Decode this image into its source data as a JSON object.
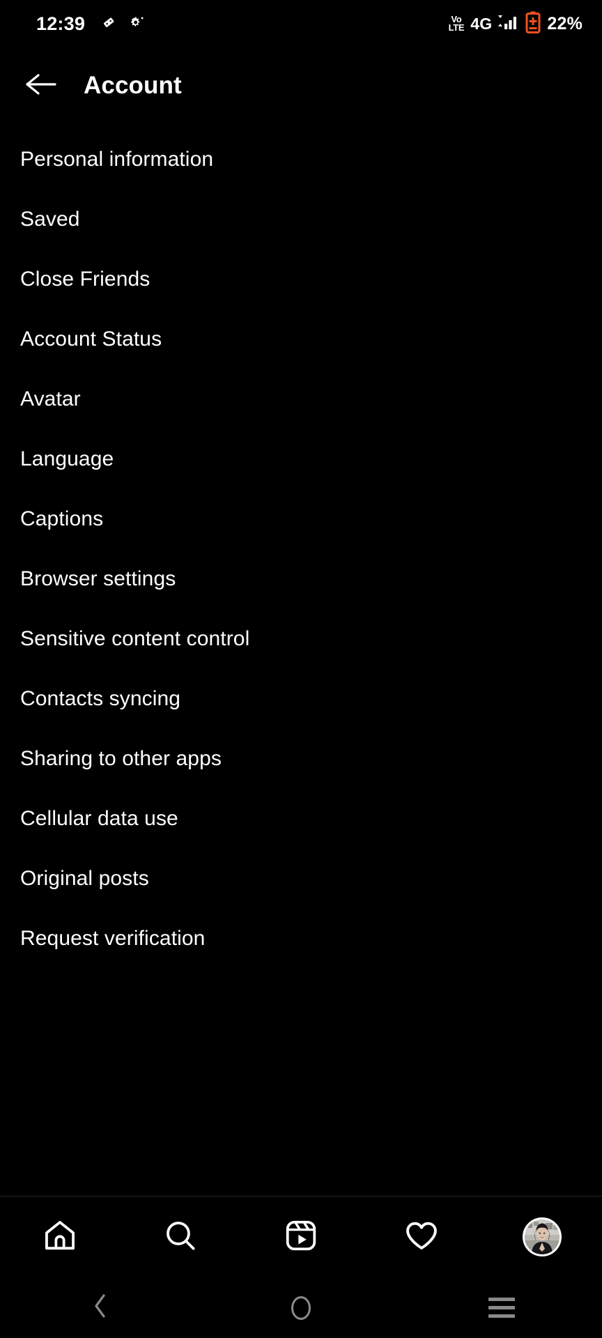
{
  "status_bar": {
    "time": "12:39",
    "left_icons": [
      "domino-icon",
      "gear-icon"
    ],
    "volte_top": "Vo",
    "volte_bottom": "LTE",
    "network": "4G",
    "signal_icon": "signal-bars-icon",
    "battery_icon": "battery-low-icon",
    "battery_color": "#F4511E",
    "battery_percent": "22%"
  },
  "header": {
    "back_icon": "back-arrow-icon",
    "title": "Account"
  },
  "menu": {
    "items": [
      {
        "label": "Personal information"
      },
      {
        "label": "Saved"
      },
      {
        "label": "Close Friends"
      },
      {
        "label": "Account Status"
      },
      {
        "label": "Avatar"
      },
      {
        "label": "Language"
      },
      {
        "label": "Captions"
      },
      {
        "label": "Browser settings"
      },
      {
        "label": "Sensitive content control"
      },
      {
        "label": "Contacts syncing"
      },
      {
        "label": "Sharing to other apps"
      },
      {
        "label": "Cellular data use"
      },
      {
        "label": "Original posts"
      },
      {
        "label": "Request verification"
      }
    ]
  },
  "bottom_nav": {
    "items": [
      {
        "name": "home-icon"
      },
      {
        "name": "search-icon"
      },
      {
        "name": "reels-icon"
      },
      {
        "name": "heart-icon"
      },
      {
        "name": "profile-avatar"
      }
    ]
  },
  "system_nav": {
    "back": "system-back-icon",
    "home": "system-home-icon",
    "recents": "system-recents-icon"
  },
  "colors": {
    "background": "#000000",
    "text": "#FFFFFF",
    "divider": "#262626",
    "system_nav_icon": "#8A8A8A",
    "battery_low": "#F4511E"
  }
}
